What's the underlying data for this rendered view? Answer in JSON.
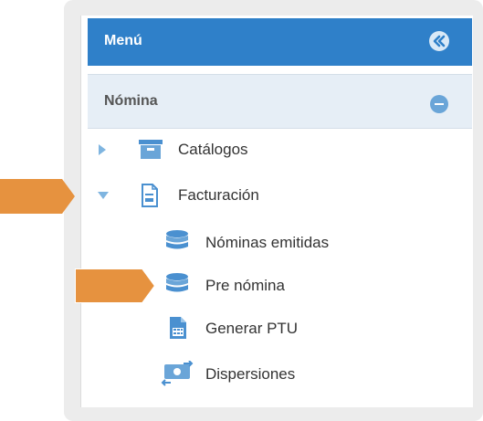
{
  "menu": {
    "title": "Menú",
    "collapse_icon": "double-chevron-left-icon"
  },
  "section": {
    "title": "Nómina",
    "toggle_icon": "minus-circle-icon"
  },
  "tree": {
    "catalogos": {
      "label": "Catálogos",
      "icon": "archive-box-icon",
      "expander": "collapsed"
    },
    "facturacion": {
      "label": "Facturación",
      "icon": "document-icon",
      "expander": "expanded"
    },
    "nominas_emitidas": {
      "label": "Nóminas emitidas",
      "icon": "database-icon"
    },
    "pre_nomina": {
      "label": "Pre nómina",
      "icon": "database-icon"
    },
    "generar_ptu": {
      "label": "Generar PTU",
      "icon": "calculator-document-icon"
    },
    "dispersiones": {
      "label": "Dispersiones",
      "icon": "money-transfer-icon"
    }
  },
  "colors": {
    "header_blue": "#2f80c9",
    "section_bg": "#e6eef6",
    "icon_blue": "#4a90d0",
    "annotation_orange": "#e6923f"
  }
}
